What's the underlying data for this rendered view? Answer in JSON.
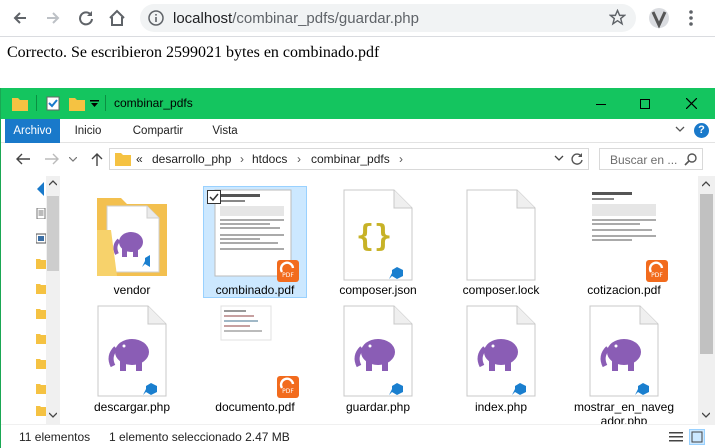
{
  "browser": {
    "url_host": "localhost",
    "url_path": "/combinar_pdfs/guardar.php"
  },
  "page": {
    "message": "Correcto. Se escribieron 2599021 bytes en combinado.pdf"
  },
  "explorer": {
    "title": "combinar_pdfs",
    "ribbon_tabs": [
      "Archivo",
      "Inicio",
      "Compartir",
      "Vista"
    ],
    "breadcrumb": {
      "overflow": "«",
      "items": [
        "desarrollo_php",
        "htdocs",
        "combinar_pdfs"
      ]
    },
    "search_placeholder": "Buscar en ...",
    "files": [
      {
        "name": "vendor",
        "type": "folder"
      },
      {
        "name": "combinado.pdf",
        "type": "pdf",
        "selected": true
      },
      {
        "name": "composer.json",
        "type": "json"
      },
      {
        "name": "composer.lock",
        "type": "blank"
      },
      {
        "name": "cotizacion.pdf",
        "type": "pdf"
      },
      {
        "name": "descargar.php",
        "type": "php"
      },
      {
        "name": "documento.pdf",
        "type": "pdf"
      },
      {
        "name": "guardar.php",
        "type": "php"
      },
      {
        "name": "index.php",
        "type": "php"
      },
      {
        "name": "mostrar_en_navegador.php",
        "type": "php"
      }
    ],
    "status": {
      "count": "11 elementos",
      "selection": "1 elemento seleccionado  2.47 MB"
    }
  },
  "colors": {
    "titlebar": "#14c55f",
    "accent": "#1979ca",
    "php": "#8a5db5",
    "vscode": "#1a7fcf",
    "foxit": "#f26b1d"
  }
}
